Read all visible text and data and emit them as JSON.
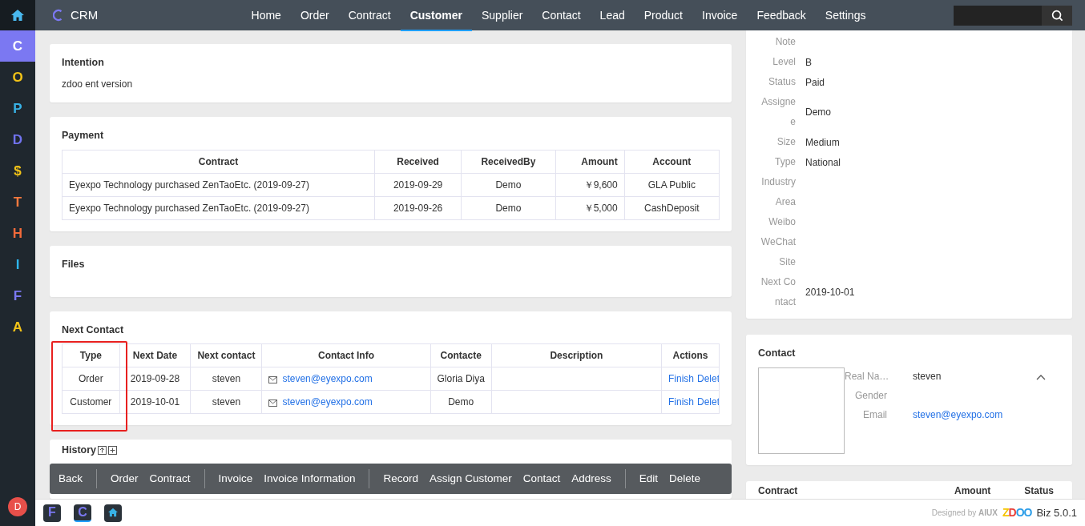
{
  "sidebar": {
    "items": [
      {
        "label": "C",
        "color": "#7b78f2",
        "selected": true
      },
      {
        "label": "O",
        "color": "#f2c318",
        "selected": false
      },
      {
        "label": "P",
        "color": "#38b2e6",
        "selected": false
      },
      {
        "label": "D",
        "color": "#7173ee",
        "selected": false
      },
      {
        "label": "$",
        "color": "#f2c318",
        "selected": false
      },
      {
        "label": "T",
        "color": "#f5793e",
        "selected": false
      },
      {
        "label": "H",
        "color": "#f26a3a",
        "selected": false
      },
      {
        "label": "I",
        "color": "#2eb5ec",
        "selected": false
      },
      {
        "label": "F",
        "color": "#7b78f2",
        "selected": false
      },
      {
        "label": "A",
        "color": "#f2c318",
        "selected": false
      }
    ],
    "user": "D"
  },
  "app": {
    "name": "CRM"
  },
  "nav": [
    {
      "label": "Home",
      "selected": false
    },
    {
      "label": "Order",
      "selected": false
    },
    {
      "label": "Contract",
      "selected": false
    },
    {
      "label": "Customer",
      "selected": true
    },
    {
      "label": "Supplier",
      "selected": false
    },
    {
      "label": "Contact",
      "selected": false
    },
    {
      "label": "Lead",
      "selected": false
    },
    {
      "label": "Product",
      "selected": false
    },
    {
      "label": "Invoice",
      "selected": false
    },
    {
      "label": "Feedback",
      "selected": false
    },
    {
      "label": "Settings",
      "selected": false
    }
  ],
  "intention": {
    "title": "Intention",
    "text": "zdoo ent version"
  },
  "payment": {
    "title": "Payment",
    "columns": [
      "Contract",
      "Received",
      "ReceivedBy",
      "Amount",
      "Account"
    ],
    "rows": [
      [
        "Eyexpo Technology purchased ZenTaoEtc. (2019-09-27)",
        "2019-09-29",
        "Demo",
        "￥9,600",
        "GLA Public"
      ],
      [
        "Eyexpo Technology purchased ZenTaoEtc. (2019-09-27)",
        "2019-09-26",
        "Demo",
        "￥5,000",
        "CashDeposit"
      ]
    ]
  },
  "files": {
    "title": "Files"
  },
  "next_contact": {
    "title": "Next Contact",
    "columns": [
      {
        "label": "Type",
        "highlighted": true
      },
      {
        "label": "Next Date",
        "highlighted": false
      },
      {
        "label": "Next contact",
        "highlighted": false
      },
      {
        "label": "Contact Info",
        "highlighted": false
      },
      {
        "label": "Contacte",
        "highlighted": false
      },
      {
        "label": "Description",
        "highlighted": false
      },
      {
        "label": "Actions",
        "highlighted": false
      }
    ],
    "rows": [
      {
        "type": "Order",
        "date": "2019-09-28",
        "contact": "steven",
        "email": "steven@eyexpo.com",
        "contacted": "Gloria Diya",
        "actions": [
          "Finish",
          "Delet"
        ]
      },
      {
        "type": "Customer",
        "date": "2019-10-01",
        "contact": "steven",
        "email": "steven@eyexpo.com",
        "contacted": "Demo",
        "actions": [
          "Finish",
          "Delet"
        ]
      }
    ]
  },
  "history": {
    "title": "History"
  },
  "action_bar": [
    [
      "Back"
    ],
    [
      "Order",
      "Contract"
    ],
    [
      "Invoice",
      "Invoice Information"
    ],
    [
      "Record",
      "Assign Customer",
      "Contact",
      "Address"
    ],
    [
      "Edit",
      "Delete"
    ]
  ],
  "info": [
    {
      "label": "Note"
    },
    {
      "label": "Level",
      "value": "B"
    },
    {
      "label": "Status",
      "value": "Paid"
    },
    {
      "label": "Assignee",
      "value": "Demo"
    },
    {
      "label": "Size",
      "value": "Medium"
    },
    {
      "label": "Type",
      "value": "National"
    },
    {
      "label": "Industry"
    },
    {
      "label": "Area"
    },
    {
      "label": "Weibo"
    },
    {
      "label": "WeChat"
    },
    {
      "label": "Site"
    },
    {
      "label": "Next Contact",
      "value": "2019-10-01"
    }
  ],
  "contact": {
    "title": "Contact",
    "fields": [
      {
        "label": "Real Na…",
        "value": "steven",
        "kind": "text"
      },
      {
        "label": "Gender",
        "kind": "text"
      },
      {
        "label": "Email",
        "value": "steven@eyexpo.com",
        "kind": "link"
      }
    ]
  },
  "contract": {
    "title": "Contract",
    "columns": [
      "Amount",
      "Status"
    ]
  },
  "taskbar": [
    {
      "label": "F",
      "color": "#7b78f2",
      "selected": false
    },
    {
      "label": "C",
      "color": "#7b78f2",
      "selected": true
    },
    {
      "kind": "home",
      "color": "#38b2e6",
      "selected": false
    }
  ],
  "footer": {
    "designed_by": "Designed by",
    "designer": "AIUX",
    "logo": "ZDOO",
    "version": "Biz 5.0.1"
  }
}
